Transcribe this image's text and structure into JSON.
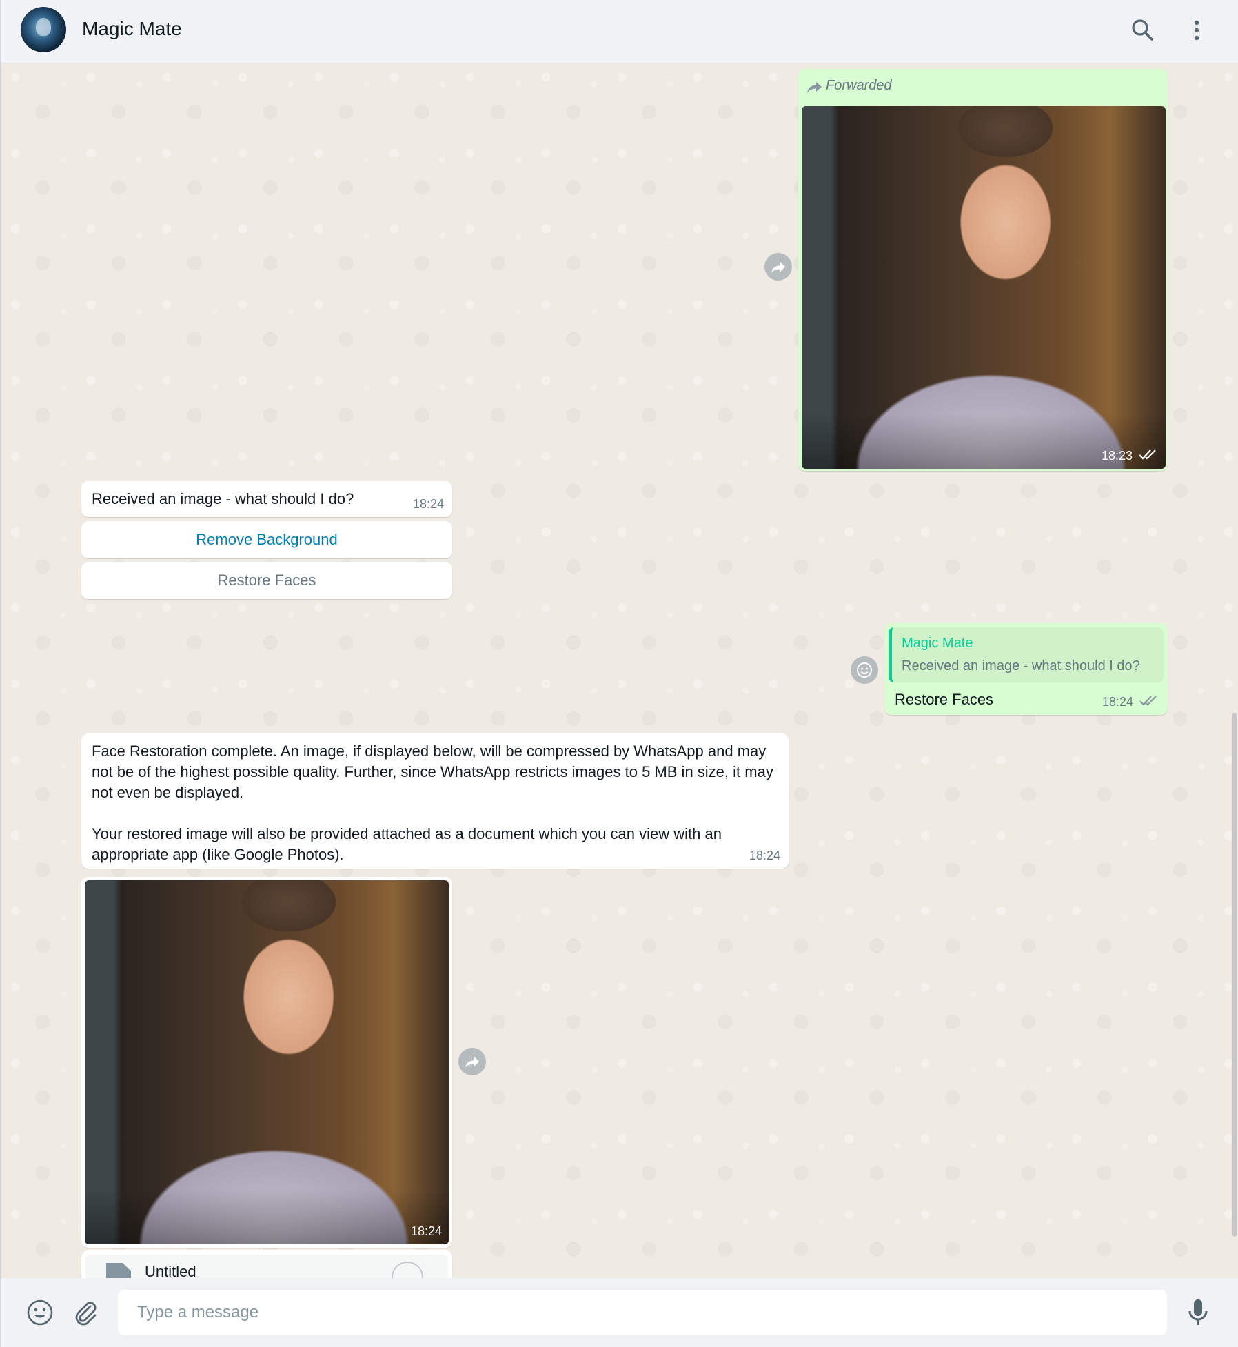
{
  "header": {
    "title": "Magic Mate",
    "avatar_icon": "wizard-avatar",
    "search_icon": "search-icon",
    "menu_icon": "more-vertical-icon"
  },
  "messages": {
    "forwarded_image": {
      "forwarded_label": "Forwarded",
      "time": "18:23",
      "status": "read"
    },
    "prompt": {
      "text": "Received an image - what should I do?",
      "time": "18:24",
      "buttons": [
        "Remove Background",
        "Restore Faces"
      ]
    },
    "reply": {
      "quoted_author": "Magic Mate",
      "quoted_text": "Received an image - what should I do?",
      "text": "Restore Faces",
      "time": "18:24",
      "status": "read"
    },
    "result_text": {
      "paragraph1": "Face Restoration complete. An image, if displayed below, will be compressed by WhatsApp and may not be of the highest possible quality. Further, since WhatsApp restricts images to 5 MB in size, it may not even be displayed.",
      "paragraph2": "Your restored image will also be provided attached as a document which you can view with an appropriate app (like Google Photos).",
      "time": "18:24"
    },
    "result_image": {
      "time": "18:24"
    },
    "document": {
      "name": "Untitled"
    }
  },
  "composer": {
    "placeholder": "Type a message",
    "emoji_icon": "emoji-icon",
    "attach_icon": "paperclip-icon",
    "mic_icon": "microphone-icon"
  },
  "colors": {
    "chat_bg": "#efeae2",
    "outgoing_bubble": "#d9fdd3",
    "incoming_bubble": "#ffffff",
    "link_button": "#027eb5",
    "quote_author": "#06cf9c",
    "read_ticks": "#53bdeb"
  }
}
